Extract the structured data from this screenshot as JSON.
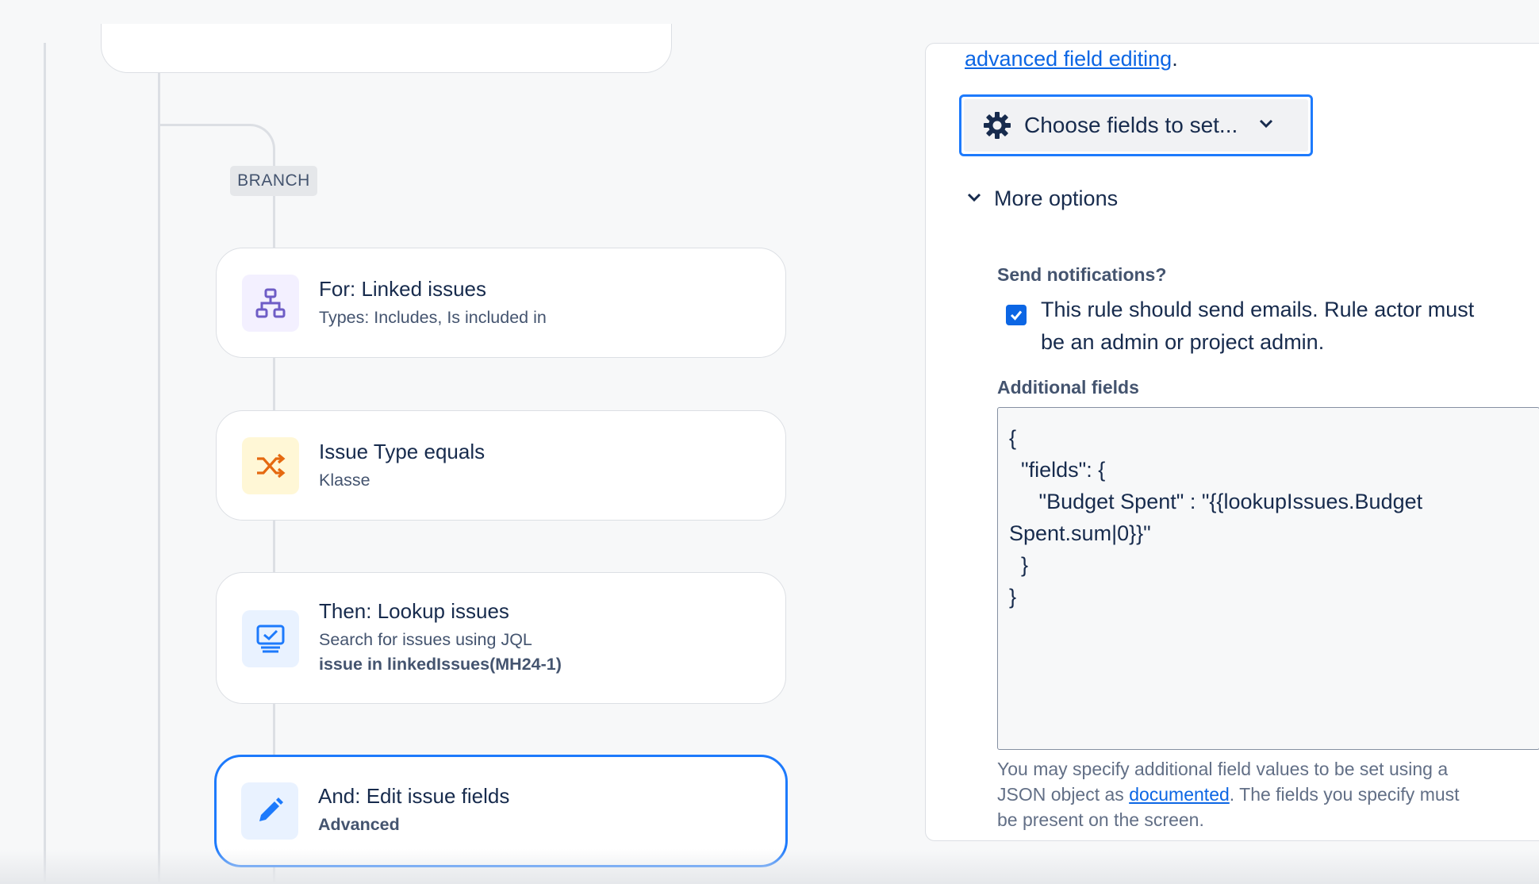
{
  "canvas": {
    "branch_label": "BRANCH",
    "cards": [
      {
        "title": "For: Linked issues",
        "subtitle": "Types: Includes, Is included in",
        "icon": "hierarchy-icon"
      },
      {
        "title": "Issue Type equals",
        "subtitle": "Klasse",
        "icon": "shuffle-icon"
      },
      {
        "title": "Then: Lookup issues",
        "subtitle": "Search for issues using JQL",
        "detail": "issue in linkedIssues(MH24-1)",
        "icon": "monitor-check-icon"
      },
      {
        "title": "And: Edit issue fields",
        "detail": "Advanced",
        "icon": "pencil-icon"
      }
    ]
  },
  "panel": {
    "top_link": "advanced field editing",
    "top_link_suffix": ".",
    "choose_fields_label": "Choose fields to set...",
    "more_options_label": "More options",
    "send_notifications_label": "Send notifications?",
    "send_notifications_checked": true,
    "send_notifications_text_line1": "This rule should send emails. Rule actor must",
    "send_notifications_text_line2": "be an admin or project admin.",
    "additional_fields_label": "Additional fields",
    "additional_fields_value": "{\n  \"fields\": {\n     \"Budget Spent\" : \"{{lookupIssues.Budget Spent.sum|0}}\"\n  }\n}",
    "help_line1": "You may specify additional field values to be set using a",
    "help_line2_prefix": "JSON object as ",
    "help_link": "documented",
    "help_line2_suffix": ". The fields you specify must",
    "help_line3": "be present on the screen."
  },
  "colors": {
    "accent": "#1d7afc",
    "link": "#0c66e4",
    "checkbox": "#0c66e4",
    "branch_icon_bg": "#f3f0ff",
    "condition_icon_bg": "#fff7d6",
    "action_icon_bg": "#e9f2ff"
  }
}
